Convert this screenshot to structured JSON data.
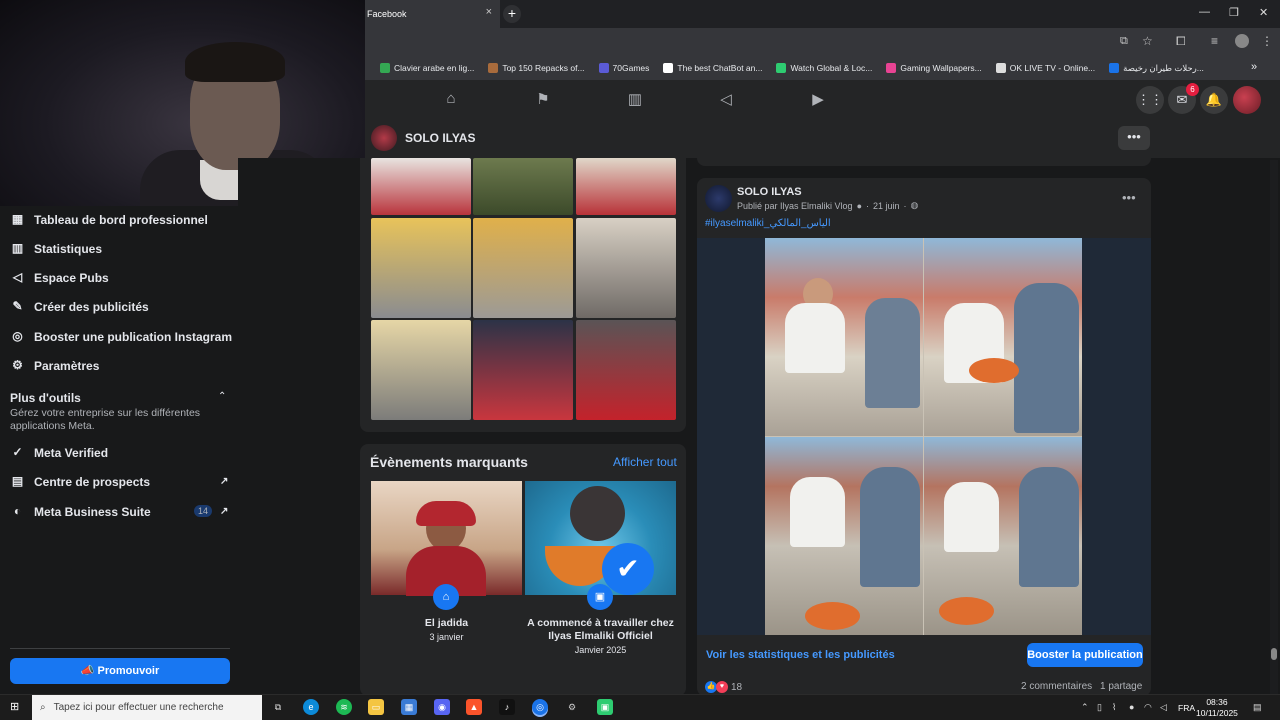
{
  "browser": {
    "tab_title": "Facebook",
    "tab_close": "×",
    "new_tab": "+",
    "window": {
      "minimize": "—",
      "restore": "❐",
      "close": "✕"
    },
    "bookmarks": [
      {
        "label": "Clavier arabe en lig...",
        "color": "#34a853"
      },
      {
        "label": "Top 150 Repacks of...",
        "color": "#a86b3c"
      },
      {
        "label": "70Games",
        "color": "#5b5bd6"
      },
      {
        "label": "The best ChatBot an...",
        "color": "#ffffff"
      },
      {
        "label": "Watch Global & Loc...",
        "color": "#2ecc71"
      },
      {
        "label": "Gaming Wallpapers...",
        "color": "#e84393"
      },
      {
        "label": "OK LIVE TV - Online...",
        "color": "#dddddd"
      },
      {
        "label": "رحلات طيران رخيصة...",
        "color": "#1a73e8"
      }
    ],
    "bookmarks_more": "»"
  },
  "fb_nav": {
    "icons": [
      "home-icon",
      "flag-icon",
      "insights-icon",
      "megaphone-icon",
      "video-icon"
    ],
    "messenger_badge": "6"
  },
  "page_header": {
    "name": "SOLO ILYAS",
    "more": "•••"
  },
  "sidebar": {
    "items": [
      {
        "label": "Tableau de bord professionnel",
        "icon": "dashboard-icon"
      },
      {
        "label": "Statistiques",
        "icon": "stats-icon"
      },
      {
        "label": "Espace Pubs",
        "icon": "megaphone-icon"
      },
      {
        "label": "Créer des publicités",
        "icon": "edit-icon"
      },
      {
        "label": "Booster une publication Instagram",
        "icon": "instagram-icon"
      },
      {
        "label": "Paramètres",
        "icon": "gear-icon"
      }
    ],
    "more_tools_title": "Plus d'outils",
    "more_tools_desc": "Gérez votre entreprise sur les différentes applications Meta.",
    "tools": [
      {
        "label": "Meta Verified",
        "icon": "verified-icon"
      },
      {
        "label": "Centre de prospects",
        "icon": "contacts-icon"
      },
      {
        "label": "Meta Business Suite",
        "icon": "business-suite-icon"
      }
    ],
    "business_suite_badge": "14",
    "promote_button": "Promouvoir"
  },
  "events": {
    "title": "Évènements marquants",
    "see_all": "Afficher tout",
    "items": [
      {
        "title": "El jadida",
        "date": "3 janvier"
      },
      {
        "title": "A commencé à travailler chez Ilyas Elmaliki Officiel",
        "date": "Janvier 2025"
      }
    ]
  },
  "post": {
    "author": "SOLO ILYAS",
    "meta": "Publié par Ilyas Elmaliki Vlog",
    "date": "21 juin",
    "hashtag": "#ilyaselmaliki_الياس_المالكي",
    "more": "•••",
    "stats_link": "Voir les statistiques et les publicités",
    "boost_button": "Booster la publication",
    "reactions_count": "18",
    "comments": "2 commentaires",
    "shares": "1 partage"
  },
  "taskbar": {
    "search_placeholder": "Tapez ici pour effectuer une recherche",
    "language": "FRA",
    "time": "08:36",
    "date": "10/11/2025"
  },
  "colors": {
    "accent": "#1877f2",
    "link": "#4599ff",
    "card": "#242526",
    "bg": "#18191a"
  }
}
